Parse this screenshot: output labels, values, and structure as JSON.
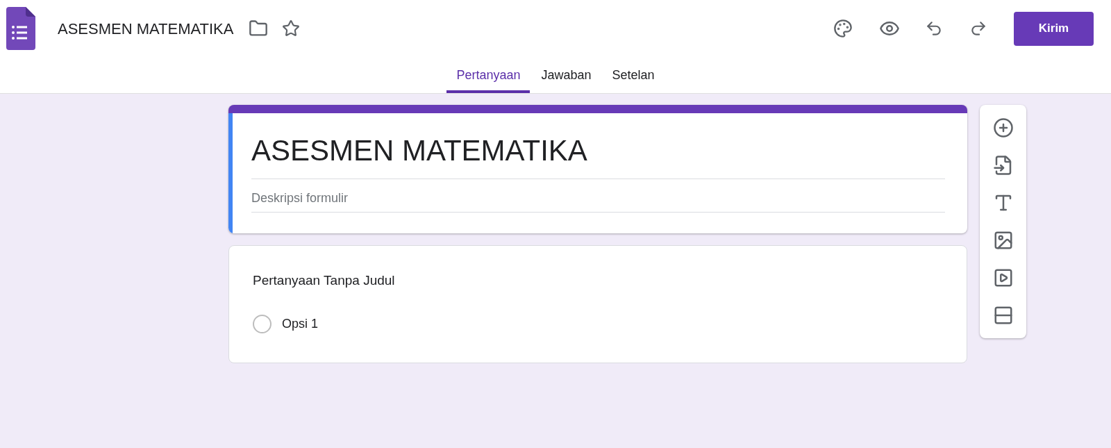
{
  "header": {
    "title": "ASESMEN MATEMATIKA",
    "send_button": "Kirim"
  },
  "tabs": [
    {
      "label": "Pertanyaan",
      "selected": true
    },
    {
      "label": "Jawaban",
      "selected": false
    },
    {
      "label": "Setelan",
      "selected": false
    }
  ],
  "form_header": {
    "title": "ASESMEN MATEMATIKA",
    "description_placeholder": "Deskripsi formulir"
  },
  "question": {
    "title": "Pertanyaan Tanpa Judul",
    "options": [
      {
        "label": "Opsi 1",
        "selected": false
      }
    ]
  }
}
